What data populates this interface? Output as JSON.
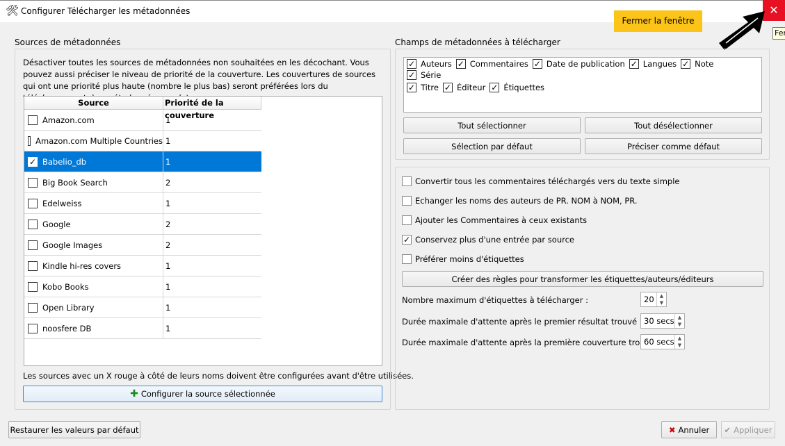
{
  "window": {
    "title": "Configurer Télécharger les métadonnées",
    "close_symbol": "✕",
    "tooltip": "Fermer"
  },
  "annotation": {
    "badge": "Fermer la fenêtre"
  },
  "sources": {
    "group_label": "Sources de métadonnées",
    "description": "Désactiver toutes les sources de métadonnées non souhaitées en les décochant. Vous pouvez aussi préciser le niveau de priorité de la couverture. Les couvertures de sources qui ont une priorité plus haute (nombre le plus bas) seront préférées lors du téléchargement des métadonnées par lot.",
    "columns": [
      "Source",
      "Priorité de la couverture"
    ],
    "rows": [
      {
        "name": "Amazon.com",
        "priority": "1",
        "checked": false
      },
      {
        "name": "Amazon.com Multiple Countries",
        "priority": "1",
        "checked": false
      },
      {
        "name": "Babelio_db",
        "priority": "1",
        "checked": true,
        "selected": true
      },
      {
        "name": "Big Book Search",
        "priority": "2",
        "checked": false
      },
      {
        "name": "Edelweiss",
        "priority": "1",
        "checked": false
      },
      {
        "name": "Google",
        "priority": "2",
        "checked": false
      },
      {
        "name": "Google Images",
        "priority": "2",
        "checked": false
      },
      {
        "name": "Kindle hi-res covers",
        "priority": "1",
        "checked": false
      },
      {
        "name": "Kobo Books",
        "priority": "1",
        "checked": false
      },
      {
        "name": "Open Library",
        "priority": "1",
        "checked": false
      },
      {
        "name": "noosfere DB",
        "priority": "1",
        "checked": false
      }
    ],
    "note": "Les sources avec un X rouge à côté de leurs noms doivent être configurées avant d'être utilisées.",
    "configure_button": "Configurer la source sélectionnée"
  },
  "fields": {
    "group_label": "Champs de métadonnées à télécharger",
    "items": [
      {
        "label": "Auteurs",
        "checked": true
      },
      {
        "label": "Commentaires",
        "checked": true
      },
      {
        "label": "Date de publication",
        "checked": true
      },
      {
        "label": "Langues",
        "checked": true
      },
      {
        "label": "Note",
        "checked": true
      },
      {
        "label": "Série",
        "checked": true
      },
      {
        "label": "Titre",
        "checked": true
      },
      {
        "label": "Éditeur",
        "checked": true
      },
      {
        "label": "Étiquettes",
        "checked": true
      }
    ],
    "select_all": "Tout sélectionner",
    "deselect_all": "Tout désélectionner",
    "default_selection": "Sélection par défaut",
    "set_default": "Préciser comme défaut"
  },
  "options": {
    "checkboxes": [
      {
        "label": "Convertir tous les commentaires téléchargés vers du texte simple",
        "checked": false
      },
      {
        "label": "Echanger les noms des auteurs de PR. NOM à NOM, PR.",
        "checked": false
      },
      {
        "label": "Ajouter les Commentaires à ceux existants",
        "checked": false
      },
      {
        "label": "Conservez plus d'une entrée par source",
        "checked": true
      },
      {
        "label": "Préférer moins d'étiquettes",
        "checked": false
      }
    ],
    "rules_button": "Créer des règles pour transformer les étiquettes/auteurs/éditeurs",
    "max_tags_label": "Nombre maximum d'étiquettes à télécharger :",
    "max_tags": "20",
    "wait_first_label": "Durée maximale d'attente après le premier résultat trouvé :",
    "wait_first": "30 secs",
    "wait_cover_label": "Durée maximale d'attente après la première couverture trouvée :",
    "wait_cover": "60 secs"
  },
  "footer": {
    "restore": "Restaurer les valeurs par défaut",
    "cancel": "Annuler",
    "apply": "Appliquer"
  },
  "colors": {
    "selection": "#0078d7",
    "close": "#e81123",
    "badge": "#fcc419"
  }
}
